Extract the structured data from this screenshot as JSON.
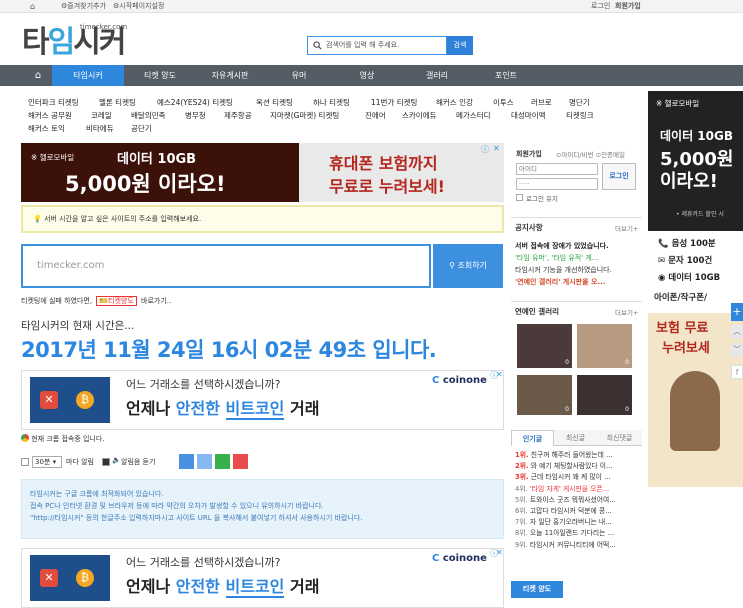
{
  "topbar": {
    "bookmark": "즐겨찾기추가",
    "homepage": "시작페이지설정",
    "login": "로그인",
    "join": "회원가입"
  },
  "logo": {
    "text_a": "타",
    "text_b": "임",
    "text_c": "시커",
    "domain": "timecker.com"
  },
  "search": {
    "placeholder": "검색어를 입력 해 주세요.",
    "button": "검색"
  },
  "nav": {
    "items": [
      "타임시커",
      "티켓 양도",
      "자유게시판",
      "유머",
      "영상",
      "갤러리",
      "포인트"
    ]
  },
  "quick_links": [
    [
      "인터파크 티켓팅",
      "멜론 티켓팅",
      "예스24(YES24) 티켓팅",
      "옥션 티켓팅",
      "하나 티켓팅",
      "11번가 티켓팅",
      "해커스 인강",
      "이투스",
      "러브로",
      "명단기"
    ],
    [
      "해커스 공무원",
      "코레일",
      "배달의민족",
      "병무청",
      "제주항공",
      "지마켓(G마켓) 티켓팅",
      "진에어",
      "스카이에듀",
      "메가스터디",
      "대성마이맥",
      "티켓링크"
    ],
    [
      "해커스 토익",
      "비타에듀",
      "공단기"
    ]
  ],
  "ad_top": {
    "brand": "헬로모바일",
    "line1": "데이터 10GB",
    "line2": "5,000원 이라오!",
    "right1": "휴대폰 보험까지",
    "right2": "무료로 누려보세!"
  },
  "notice": {
    "text": "서버 시간을 알고 싶은 사이트의 주소를 입력해보세요.",
    "highlight": "입력"
  },
  "url_input": {
    "placeholder": "timecker.com",
    "button": "조회하기"
  },
  "retry": {
    "prefix": "티켓팅에 실패 하였다면,",
    "tag": "티켓양도",
    "suffix": "바로가기.."
  },
  "current_label": "타임시커의 현재 시간은...",
  "current_time": "2017년 11월 24일 16시 02분 49초 입니다.",
  "coin_ad": {
    "q": "어느 거래소를 선택하시겠습니까?",
    "a1": "언제나",
    "a2": "안전한",
    "a3": "비트코인",
    "a4": "거래",
    "brand": "coinone"
  },
  "browser_line": "현재 크롬 접속중 입니다.",
  "alarm": {
    "select": "30분",
    "label1": "마다 알림",
    "label2": "알림음 듣기"
  },
  "alarm_colors": [
    "#4a90e2",
    "#86b7f0",
    "#35b04a",
    "#e84c4c"
  ],
  "info": [
    "타임시커는 구글 크롬에 최적화되어 있습니다.",
    "접속 PC나 인터넷 환경 및 브라우저 등에 따라 약간의 오차가 발생할 수 있으니 유의하시기 바랍니다.",
    "\"http://타임시커\" 등의 한글주소 입력하지마시고 사이트 URL 을 복사해서 붙여넣기 하셔서 사용하시기 바랍니다."
  ],
  "login_panel": {
    "tab1": "회원가입",
    "link1": "아이디/비번",
    "link2": "인증메일",
    "id_placeholder": "아이디",
    "pw_placeholder": "·····",
    "button": "로그인",
    "keep": "로그인 유지"
  },
  "notice_panel": {
    "title": "공지사항",
    "more": "더보기+",
    "items": [
      "서버 접속에 장애가 있었습니다.",
      "'타임 유머', '타임 유적' 게...",
      "타임시커 기능을 개선하였습니다.",
      "'연예인 갤러리' 게시판을 오..."
    ]
  },
  "gallery_panel": {
    "title": "연예인 갤러리",
    "more": "더보기+",
    "counts": [
      "0",
      "0",
      "0",
      "0"
    ]
  },
  "popular": {
    "tabs": [
      "인기글",
      "최신글",
      "최신댓글"
    ],
    "items": [
      [
        "1위.",
        "친구꺼 해주러 들어왔는데 ..."
      ],
      [
        "2위.",
        "와 예기 체팅할사람있다 이..."
      ],
      [
        "3위.",
        "근데 타임시커 왜 케 많이 ..."
      ],
      [
        "4위.",
        "'타임 자게' 게시판을 오픈..."
      ],
      [
        "5위.",
        "트와이스 굿즈 뭐뭐사셨어여..."
      ],
      [
        "6위.",
        "고맙다 타임시커 덕분에 콩..."
      ],
      [
        "7위.",
        "자 일단 홍기오라버니는 내..."
      ],
      [
        "8위.",
        "오늘 11아일랜드 기다리는 ..."
      ],
      [
        "9위.",
        "타임시커 커뮤니티티에 어떡..."
      ]
    ],
    "bottom_tab": "티켓 양도"
  },
  "right_ad": {
    "brand": "헬로모바일",
    "line1": "데이터 10GB",
    "line2": "5,000원",
    "line3": "이라오!",
    "fine": "• 제휴카드 할인 시",
    "f1": "음성 100분",
    "f2": "문자 100건",
    "f3": "데이터 10GB",
    "f4": "아이폰/작구폰/",
    "f5": "보험 무료",
    "f6": "누려보세"
  }
}
